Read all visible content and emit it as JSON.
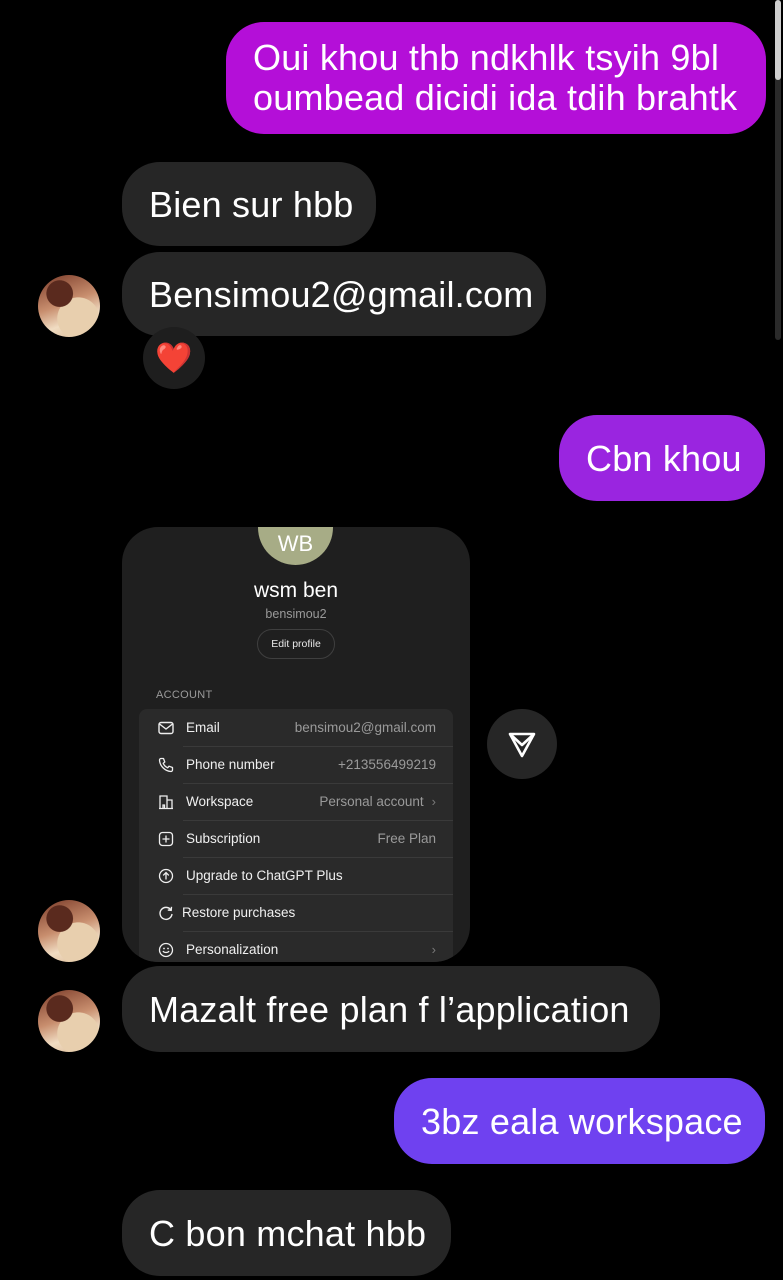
{
  "messages": {
    "m1": "Oui khou thb ndkhlk tsyih 9bl oumbead dicidi ida tdih brahtk",
    "m2": "Bien sur hbb",
    "m3": "Bensimou2@gmail.com",
    "m3_reaction": "❤️",
    "m4": "Cbn khou",
    "m5": "Mazalt free plan f l’application",
    "m6": "3bz eala workspace",
    "m7": "C bon mchat hbb"
  },
  "shared_screenshot": {
    "avatar_initials": "WB",
    "display_name": "wsm ben",
    "username": "bensimou2",
    "edit_profile_label": "Edit profile",
    "section_title": "ACCOUNT",
    "rows": [
      {
        "icon": "mail-icon",
        "label": "Email",
        "value": "bensimou2@gmail.com",
        "chevron": false
      },
      {
        "icon": "phone-icon",
        "label": "Phone number",
        "value": "+213556499219",
        "chevron": false
      },
      {
        "icon": "building-icon",
        "label": "Workspace",
        "value": "Personal account",
        "chevron": true
      },
      {
        "icon": "plus-square-icon",
        "label": "Subscription",
        "value": "Free Plan",
        "chevron": false
      },
      {
        "icon": "arrow-up-circle-icon",
        "label": "Upgrade to ChatGPT Plus",
        "value": "",
        "chevron": false
      },
      {
        "icon": "restore-icon",
        "label": "Restore purchases",
        "value": "",
        "chevron": false
      },
      {
        "icon": "personalization-icon",
        "label": "Personalization",
        "value": "",
        "chevron": true
      }
    ]
  },
  "colors": {
    "background": "#000000",
    "sent_pink": "#b40fd8",
    "sent_purple": "#9a25e0",
    "sent_violet": "#6f41f0",
    "received": "#262626"
  }
}
